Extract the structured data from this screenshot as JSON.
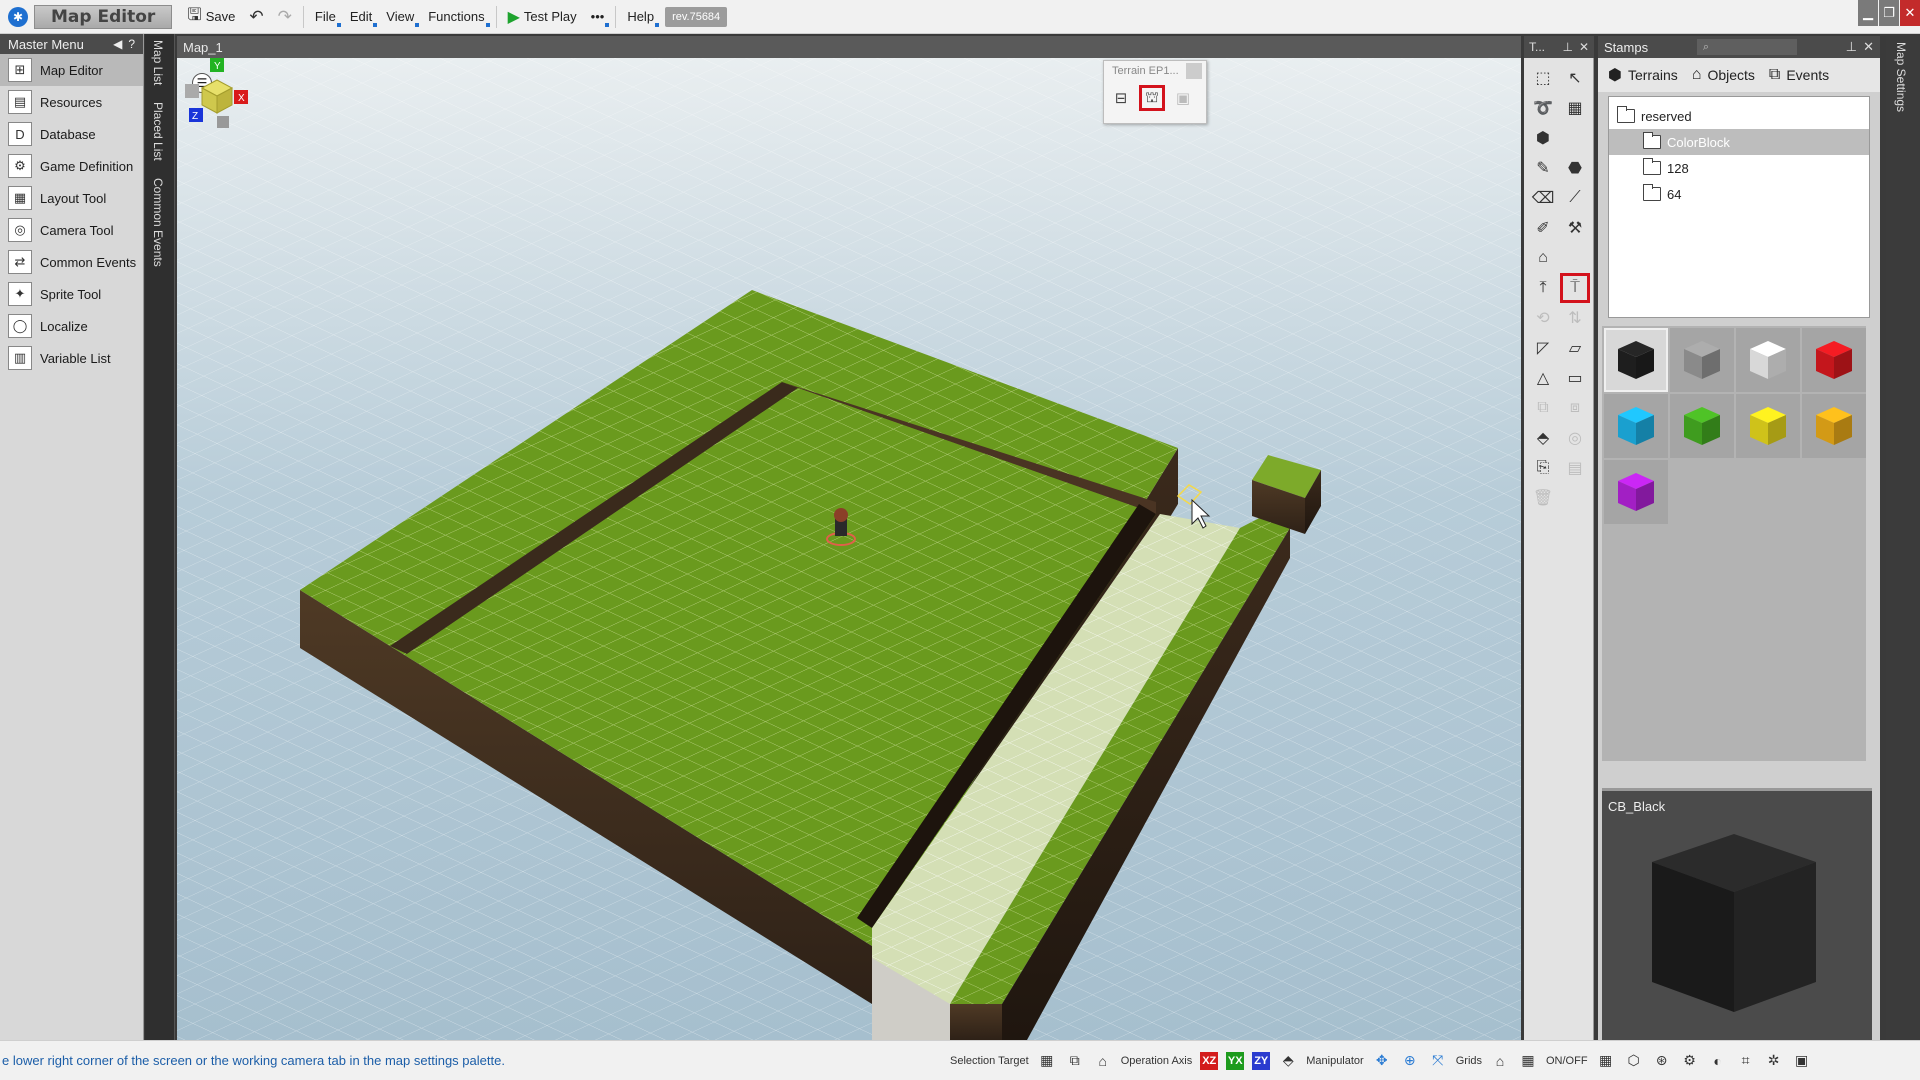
{
  "app": {
    "title": "Map Editor",
    "rev": "rev.75684"
  },
  "toolbar": {
    "save_label": "Save",
    "menus": [
      "File",
      "Edit",
      "View",
      "Functions"
    ],
    "test_play_label": "Test Play",
    "more_label": "•••",
    "help_label": "Help"
  },
  "master_menu": {
    "title": "Master Menu",
    "items": [
      {
        "label": "Map Editor",
        "icon": "map-editor-icon",
        "glyph": "⊞"
      },
      {
        "label": "Resources",
        "icon": "resources-icon",
        "glyph": "▤"
      },
      {
        "label": "Database",
        "icon": "database-icon",
        "glyph": "D"
      },
      {
        "label": "Game Definition",
        "icon": "game-definition-icon",
        "glyph": "⚙"
      },
      {
        "label": "Layout Tool",
        "icon": "layout-tool-icon",
        "glyph": "▦"
      },
      {
        "label": "Camera Tool",
        "icon": "camera-tool-icon",
        "glyph": "◎"
      },
      {
        "label": "Common Events",
        "icon": "common-events-icon",
        "glyph": "⇄"
      },
      {
        "label": "Sprite Tool",
        "icon": "sprite-tool-icon",
        "glyph": "✦"
      },
      {
        "label": "Localize",
        "icon": "localize-icon",
        "glyph": "◯"
      },
      {
        "label": "Variable List",
        "icon": "variable-list-icon",
        "glyph": "▥"
      }
    ]
  },
  "side_tabs": [
    "Map List",
    "Placed List",
    "Common Events"
  ],
  "viewport": {
    "tab_title": "Map_1"
  },
  "terrain_popup": {
    "title": "Terrain EP1..."
  },
  "tools_panel": {
    "title": "T..."
  },
  "stamps": {
    "title": "Stamps",
    "tabs": [
      {
        "label": "Terrains",
        "icon": "terrain-cube-icon"
      },
      {
        "label": "Objects",
        "icon": "objects-house-icon"
      },
      {
        "label": "Events",
        "icon": "events-icon"
      }
    ],
    "tree": [
      {
        "label": "reserved",
        "depth": 0
      },
      {
        "label": "ColorBlock",
        "depth": 1,
        "selected": true
      },
      {
        "label": "128",
        "depth": 1
      },
      {
        "label": "64",
        "depth": 1
      }
    ],
    "swatches": [
      {
        "name": "black",
        "color": "#1e1e1e"
      },
      {
        "name": "gray",
        "color": "#8a8a8a"
      },
      {
        "name": "white",
        "color": "#d8d8d8"
      },
      {
        "name": "red",
        "color": "#c4161c"
      },
      {
        "name": "cyan",
        "color": "#1aa0cf"
      },
      {
        "name": "green",
        "color": "#3f9c1f"
      },
      {
        "name": "yellow",
        "color": "#cfc21a"
      },
      {
        "name": "orange",
        "color": "#d39a16"
      },
      {
        "name": "purple",
        "color": "#a21fc4"
      }
    ],
    "preview_title": "CB_Black"
  },
  "right_tab": "Map Settings",
  "status": {
    "message": "e lower right corner of the screen or the working camera tab in the map settings palette.",
    "selection_target": "Selection Target",
    "operation_axis": "Operation Axis",
    "axes": [
      "XZ",
      "YX",
      "ZY"
    ],
    "manipulator": "Manipulator",
    "grids": "Grids",
    "onoff": "ON/OFF"
  },
  "colors": {
    "accent_red": "#d3121c",
    "grass": "#6a9a1e",
    "dirt": "#4a3322"
  }
}
